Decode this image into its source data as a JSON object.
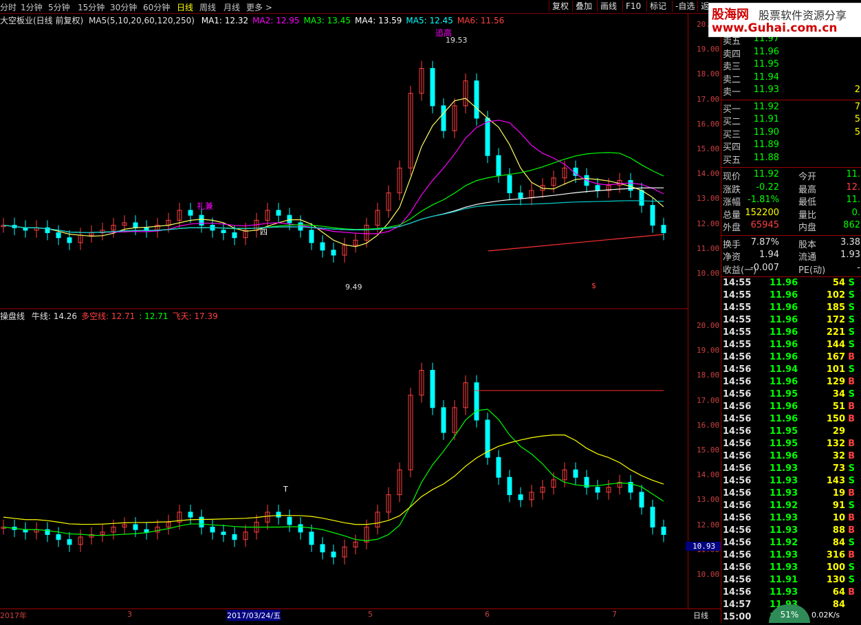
{
  "toolbar": {
    "periods": [
      "分时",
      "1分钟",
      "5分钟",
      "15分钟",
      "30分钟",
      "60分钟",
      "日线",
      "周线",
      "月线",
      "更多 >"
    ],
    "active_period": "日线",
    "buttons": [
      "复权",
      "叠加",
      "画线",
      "F10",
      "标记",
      "-自选",
      "返"
    ]
  },
  "main_chart": {
    "title": "大空板业(日线 前复权)",
    "ma_params": "MA5(5,10,20,60,120,250)",
    "ma": [
      {
        "label": "MA1: 12.32",
        "color": "#ffffff"
      },
      {
        "label": "MA2: 12.95",
        "color": "#ff00ff"
      },
      {
        "label": "MA3: 13.45",
        "color": "#00ff00"
      },
      {
        "label": "MA4: 13.59",
        "color": "#ffffff"
      },
      {
        "label": "MA5: 12.45",
        "color": "#00ffff"
      },
      {
        "label": "MA6: 11.56",
        "color": "#ff4040"
      }
    ],
    "annotations": {
      "high_label": "19.53",
      "low_label": "9.49",
      "breakout_text": "追高",
      "buy_text": "礼兼",
      "letter_marker": "四",
      "dollar": "$"
    },
    "y_ticks": [
      "20.00",
      "19.00",
      "18.00",
      "17.00",
      "16.00",
      "15.00",
      "14.00",
      "13.00",
      "12.00",
      "11.00",
      "10.00"
    ]
  },
  "sub_chart": {
    "title": "操盘线",
    "legend": [
      {
        "label": "牛线: 14.26",
        "color": "#e0e0e0"
      },
      {
        "label": "多空线: 12.71",
        "color": "#ff4040"
      },
      {
        "label": ": 12.71",
        "color": "#00ff00"
      },
      {
        "label": "飞天: 17.39",
        "color": "#ff4040"
      }
    ],
    "y_ticks": [
      "20.00",
      "19.00",
      "18.00",
      "17.00",
      "16.00",
      "15.00",
      "14.00",
      "13.00",
      "12.00",
      "11.00",
      "10.00"
    ],
    "cursor_price": "10.93",
    "letter_marker": "T"
  },
  "x_axis": {
    "ticks": [
      {
        "label": "2017年",
        "pos": 0.0
      },
      {
        "label": "3",
        "pos": 0.185
      },
      {
        "label": "2017/03/24/五",
        "pos": 0.33
      },
      {
        "label": "5",
        "pos": 0.535
      },
      {
        "label": "6",
        "pos": 0.705
      },
      {
        "label": "7",
        "pos": 0.89
      }
    ],
    "right_label": "日线"
  },
  "quote": {
    "sell": [
      {
        "label": "卖五",
        "price": "11.97",
        "vol": ""
      },
      {
        "label": "卖四",
        "price": "11.96",
        "vol": ""
      },
      {
        "label": "卖三",
        "price": "11.95",
        "vol": ""
      },
      {
        "label": "卖二",
        "price": "11.94",
        "vol": ""
      },
      {
        "label": "卖一",
        "price": "11.93",
        "vol": "2"
      }
    ],
    "buy": [
      {
        "label": "买一",
        "price": "11.92",
        "vol": "7"
      },
      {
        "label": "买二",
        "price": "11.91",
        "vol": "5"
      },
      {
        "label": "买三",
        "price": "11.90",
        "vol": "5"
      },
      {
        "label": "买四",
        "price": "11.89",
        "vol": ""
      },
      {
        "label": "买五",
        "price": "11.88",
        "vol": ""
      }
    ],
    "stats": [
      {
        "l1": "现价",
        "v1": "11.92",
        "c1": "dn",
        "l2": "今开",
        "v2": "11.",
        "c2": "dn"
      },
      {
        "l1": "涨跌",
        "v1": "-0.22",
        "c1": "dn",
        "l2": "最高",
        "v2": "12.",
        "c2": "up"
      },
      {
        "l1": "涨幅",
        "v1": "-1.81%",
        "c1": "dn",
        "l2": "最低",
        "v2": "11.",
        "c2": "dn"
      },
      {
        "l1": "总量",
        "v1": "152200",
        "c1": "yl",
        "l2": "量比",
        "v2": "0.",
        "c2": "dn"
      },
      {
        "l1": "外盘",
        "v1": "65945",
        "c1": "up",
        "l2": "内盘",
        "v2": "862",
        "c2": "dn"
      }
    ],
    "stats2": [
      {
        "l1": "换手",
        "v1": "7.87%",
        "l2": "股本",
        "v2": "3.38"
      },
      {
        "l1": "净资",
        "v1": "1.94",
        "l2": "流通",
        "v2": "1.93"
      },
      {
        "l1": "收益(一)",
        "v1": "-0.007",
        "l2": "PE(动)",
        "v2": "-"
      }
    ]
  },
  "ticks": [
    {
      "t": "14:55",
      "p": "11.96",
      "v": "54",
      "bs": "S"
    },
    {
      "t": "14:55",
      "p": "11.96",
      "v": "102",
      "bs": "S"
    },
    {
      "t": "14:55",
      "p": "11.96",
      "v": "185",
      "bs": "S"
    },
    {
      "t": "14:55",
      "p": "11.96",
      "v": "172",
      "bs": "S"
    },
    {
      "t": "14:55",
      "p": "11.96",
      "v": "221",
      "bs": "S"
    },
    {
      "t": "14:55",
      "p": "11.96",
      "v": "144",
      "bs": "S"
    },
    {
      "t": "14:56",
      "p": "11.96",
      "v": "167",
      "bs": "B"
    },
    {
      "t": "14:56",
      "p": "11.94",
      "v": "101",
      "bs": "S"
    },
    {
      "t": "14:56",
      "p": "11.96",
      "v": "129",
      "bs": "B"
    },
    {
      "t": "14:56",
      "p": "11.95",
      "v": "34",
      "bs": "S"
    },
    {
      "t": "14:56",
      "p": "11.96",
      "v": "51",
      "bs": "B"
    },
    {
      "t": "14:56",
      "p": "11.96",
      "v": "150",
      "bs": "B"
    },
    {
      "t": "14:56",
      "p": "11.95",
      "v": "29",
      "bs": ""
    },
    {
      "t": "14:56",
      "p": "11.95",
      "v": "132",
      "bs": "B"
    },
    {
      "t": "14:56",
      "p": "11.96",
      "v": "32",
      "bs": "B"
    },
    {
      "t": "14:56",
      "p": "11.93",
      "v": "73",
      "bs": "S"
    },
    {
      "t": "14:56",
      "p": "11.93",
      "v": "143",
      "bs": "S"
    },
    {
      "t": "14:56",
      "p": "11.93",
      "v": "19",
      "bs": "B"
    },
    {
      "t": "14:56",
      "p": "11.92",
      "v": "91",
      "bs": "S"
    },
    {
      "t": "14:56",
      "p": "11.93",
      "v": "10",
      "bs": "B"
    },
    {
      "t": "14:56",
      "p": "11.93",
      "v": "88",
      "bs": "B"
    },
    {
      "t": "14:56",
      "p": "11.92",
      "v": "84",
      "bs": "S"
    },
    {
      "t": "14:56",
      "p": "11.93",
      "v": "316",
      "bs": "B"
    },
    {
      "t": "14:56",
      "p": "11.93",
      "v": "100",
      "bs": "S"
    },
    {
      "t": "14:56",
      "p": "11.91",
      "v": "130",
      "bs": "S"
    },
    {
      "t": "14:56",
      "p": "11.93",
      "v": "64",
      "bs": "B"
    },
    {
      "t": "14:57",
      "p": "11.93",
      "v": "84",
      "bs": ""
    },
    {
      "t": "15:00",
      "p": "11.",
      "v": "",
      "bs": ""
    }
  ],
  "logo": {
    "name": "股海网",
    "slogan": "股票软件资源分享",
    "url": "www.Guhai.com.cn"
  },
  "status": {
    "speed": "51%",
    "net": "0.02K/s"
  }
}
